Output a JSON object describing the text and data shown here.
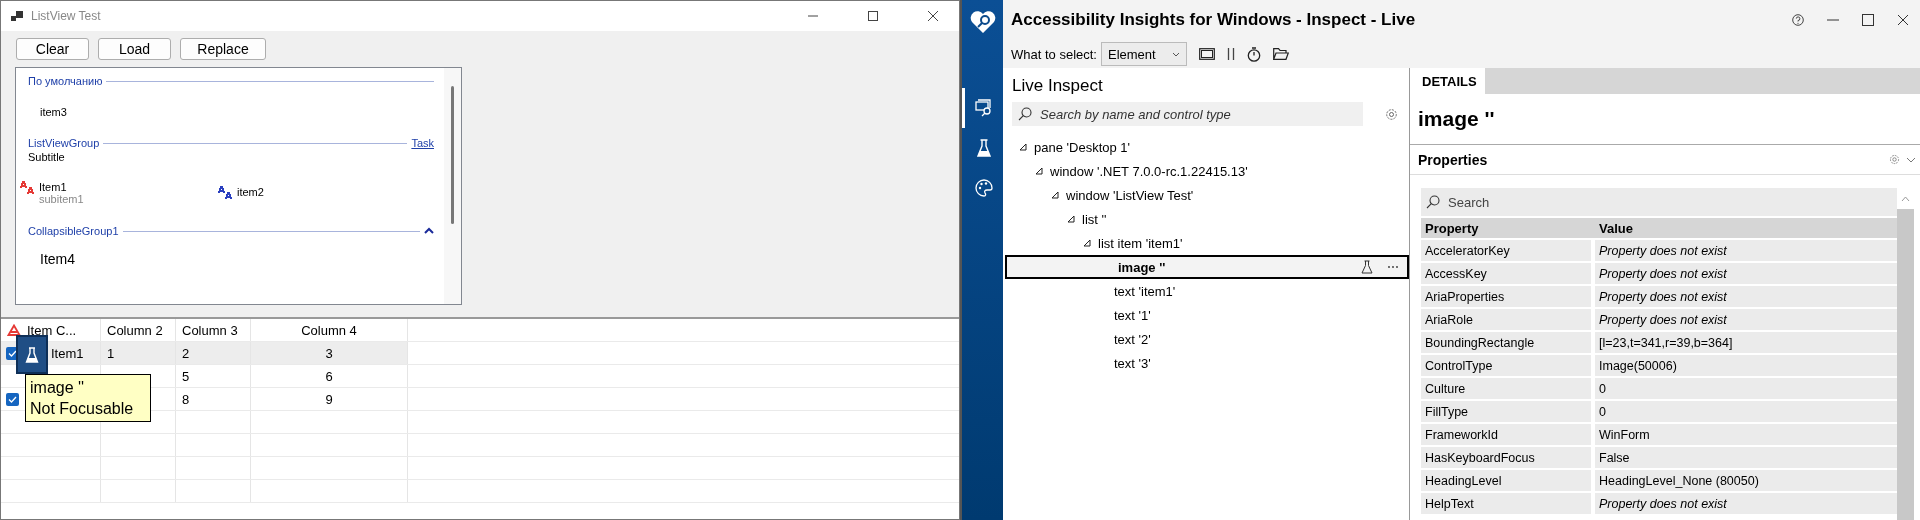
{
  "listview_window": {
    "title": "ListView Test",
    "buttons": [
      "Clear",
      "Load",
      "Replace"
    ],
    "groups": [
      {
        "header": "По умолчанию",
        "kind": "plain",
        "items": [
          {
            "text": "item3"
          }
        ]
      },
      {
        "header": "ListViewGroup",
        "kind": "task",
        "task": "Task",
        "subtitle": "Subtitle",
        "items": [
          {
            "text": "Item1",
            "subitem": "subitem1",
            "color": "#e53935"
          },
          {
            "text": "item2",
            "color": "#2a3fbf"
          }
        ]
      },
      {
        "header": "CollapsibleGroup1",
        "kind": "collapsible",
        "expanded": true,
        "items": [
          {
            "text": "Item4"
          }
        ]
      }
    ],
    "details_list": {
      "columns": [
        "Item C...",
        "Column 2",
        "Column 3",
        "Column 4"
      ],
      "rows": [
        {
          "selected": true,
          "checked": true,
          "cells": [
            "Item1",
            "1",
            "2",
            "3"
          ]
        },
        {
          "selected": false,
          "checked": false,
          "cells": [
            null,
            null,
            "5",
            "6"
          ]
        },
        {
          "selected": false,
          "checked": true,
          "cells": [
            null,
            null,
            "8",
            "9"
          ]
        }
      ],
      "tooltip": {
        "title": "image ''",
        "subtitle": "Not Focusable"
      }
    }
  },
  "inspect_window": {
    "title": "Accessibility Insights for Windows - Inspect - Live",
    "sidebar": {
      "items": [
        {
          "kind": "inspect",
          "selected": true
        },
        {
          "kind": "test",
          "selected": false
        },
        {
          "kind": "color",
          "selected": false
        }
      ]
    },
    "toolbar": {
      "label": "What to select:",
      "select_value": "Element"
    },
    "live_inspect": {
      "title": "Live Inspect",
      "search_placeholder": "Search by name and control type",
      "tree": [
        {
          "label": "pane 'Desktop 1'",
          "selected": false,
          "expanded": true,
          "children": [
            {
              "label": "window '.NET 7.0.0-rc.1.22415.13'",
              "selected": false,
              "expanded": true,
              "children": [
                {
                  "label": "window 'ListView Test'",
                  "selected": false,
                  "expanded": true,
                  "children": [
                    {
                      "label": "list ''",
                      "selected": false,
                      "expanded": true,
                      "children": [
                        {
                          "label": "list item 'item1'",
                          "selected": false,
                          "expanded": true,
                          "children": [
                            {
                              "label": "image ''",
                              "selected": true
                            },
                            {
                              "label": "text 'item1'",
                              "selected": false
                            },
                            {
                              "label": "text '1'",
                              "selected": false
                            },
                            {
                              "label": "text '2'",
                              "selected": false
                            },
                            {
                              "label": "text '3'",
                              "selected": false
                            }
                          ]
                        }
                      ]
                    }
                  ]
                }
              ]
            }
          ]
        }
      ]
    },
    "details": {
      "tabs": [
        {
          "label": "DETAILS",
          "selected": true
        }
      ],
      "element_title": "image ''",
      "properties": {
        "title": "Properties",
        "search_placeholder": "Search",
        "columns": [
          "Property",
          "Value"
        ],
        "rows": [
          {
            "property": "AcceleratorKey",
            "value": "Property does not exist",
            "exists": false
          },
          {
            "property": "AccessKey",
            "value": "Property does not exist",
            "exists": false
          },
          {
            "property": "AriaProperties",
            "value": "Property does not exist",
            "exists": false
          },
          {
            "property": "AriaRole",
            "value": "Property does not exist",
            "exists": false
          },
          {
            "property": "BoundingRectangle",
            "value": "[l=23,t=341,r=39,b=364]",
            "exists": true
          },
          {
            "property": "ControlType",
            "value": "Image(50006)",
            "exists": true
          },
          {
            "property": "Culture",
            "value": "0",
            "exists": true
          },
          {
            "property": "FillType",
            "value": "0",
            "exists": true
          },
          {
            "property": "FrameworkId",
            "value": "WinForm",
            "exists": true
          },
          {
            "property": "HasKeyboardFocus",
            "value": "False",
            "exists": true
          },
          {
            "property": "HeadingLevel",
            "value": "HeadingLevel_None (80050)",
            "exists": true
          },
          {
            "property": "HelpText",
            "value": "Property does not exist",
            "exists": false
          }
        ]
      }
    }
  }
}
